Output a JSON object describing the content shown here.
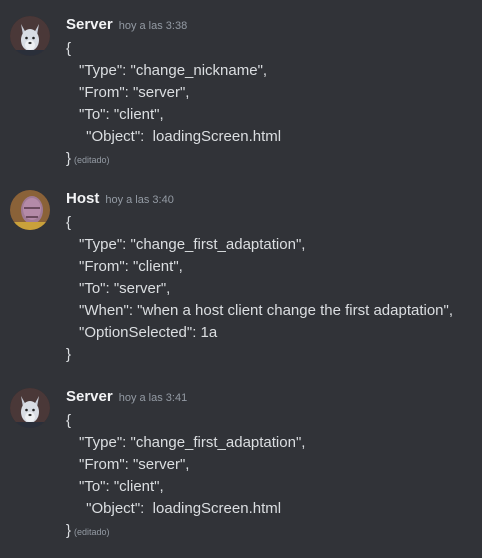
{
  "messages": [
    {
      "username": "Server",
      "timestamp": "hoy a las 3:38",
      "avatar_icon": "wolf-avatar-icon",
      "lines": [
        "{",
        "\"Type\": \"change_nickname\",",
        "\"From\": \"server\",",
        "\"To\": \"client\",",
        " \"Object\":  loadingScreen.html",
        "}"
      ],
      "edited_label": "(editado)"
    },
    {
      "username": "Host",
      "timestamp": "hoy a las 3:40",
      "avatar_icon": "thanos-avatar-icon",
      "lines": [
        "{",
        "\"Type\": \"change_first_adaptation\",",
        "\"From\": \"client\",",
        "\"To\": \"server\",",
        "\"When\": \"when a host client change the first adaptation\",",
        "\"OptionSelected\": 1a",
        "}"
      ]
    },
    {
      "username": "Server",
      "timestamp": "hoy a las 3:41",
      "avatar_icon": "wolf-avatar-icon",
      "lines": [
        "{",
        "\"Type\": \"change_first_adaptation\",",
        "\"From\": \"server\",",
        "\"To\": \"client\",",
        " \"Object\":  loadingScreen.html",
        "}"
      ],
      "edited_label": "(editado)"
    }
  ],
  "colors": {
    "background": "#313338",
    "username": "#f2f3f5",
    "text": "#dbdee1",
    "muted": "#949ba4"
  }
}
